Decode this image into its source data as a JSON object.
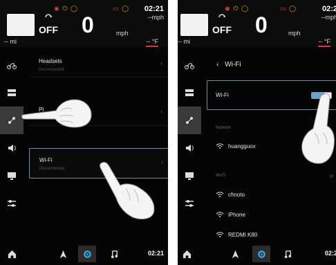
{
  "status": {
    "warning_icons": [
      "engine-warning-icon",
      "power-icon",
      "oil-icon",
      "battery-icon"
    ],
    "clock": "02:21",
    "speed_unit_small": "--mph",
    "mode": "OFF",
    "speed": "0",
    "speed_unit": "mph",
    "odometer": "-- mi",
    "temperature": "-- °F"
  },
  "left": {
    "rows": [
      {
        "label": "Headsets",
        "sub": "Disconnected"
      },
      {
        "label": "Pl",
        "sub": ""
      },
      {
        "label": "Wi-Fi",
        "sub": "Disconnected"
      }
    ]
  },
  "right": {
    "header": "Wi-Fi",
    "toggle_label": "Wi-Fi",
    "network_section": "Network",
    "connected_network": "huangguox",
    "wifi_section": "Wi-Fi",
    "networks": [
      "cfmoto",
      "iPhone",
      "REDMI K80"
    ],
    "clock_partial": "02:2",
    "mph_partial": "--mph"
  },
  "sidebar_icons": [
    "motorcycle-icon",
    "dashboard-icon",
    "connectivity-icon",
    "volume-icon",
    "display-icon",
    "sliders-icon"
  ],
  "nav_icons": [
    "home-icon",
    "navigation-arrow-icon",
    "settings-gear-icon",
    "music-note-icon"
  ]
}
